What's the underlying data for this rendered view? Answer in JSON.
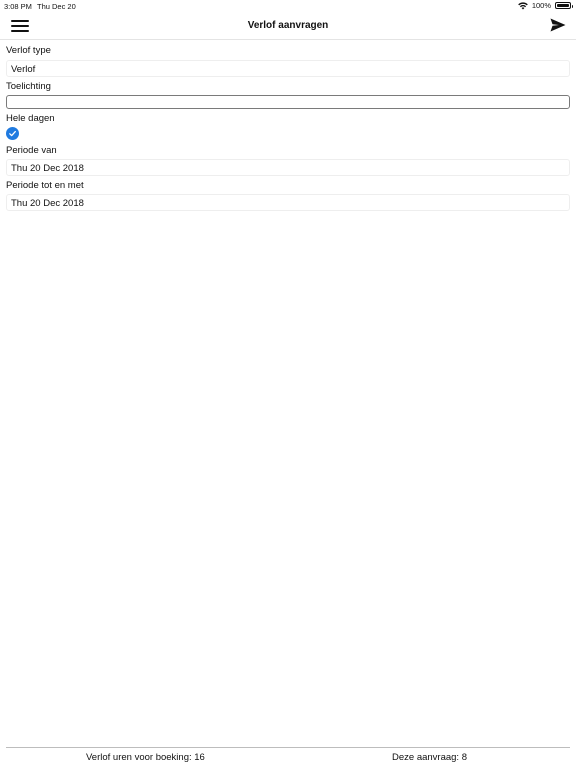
{
  "status_bar": {
    "time": "3:08 PM",
    "date": "Thu Dec 20",
    "battery": "100%"
  },
  "nav": {
    "title": "Verlof aanvragen"
  },
  "form": {
    "type_label": "Verlof type",
    "type_value": "Verlof",
    "note_label": "Toelichting",
    "note_value": "",
    "full_days_label": "Hele dagen",
    "full_days_checked": true,
    "from_label": "Periode van",
    "from_value": "Thu 20 Dec 2018",
    "to_label": "Periode tot en met",
    "to_value": "Thu 20 Dec 2018"
  },
  "footer": {
    "hours_text": "Verlof uren voor boeking: 16",
    "request_text": "Deze aanvraag: 8"
  },
  "colors": {
    "accent": "#1f7ae0"
  }
}
